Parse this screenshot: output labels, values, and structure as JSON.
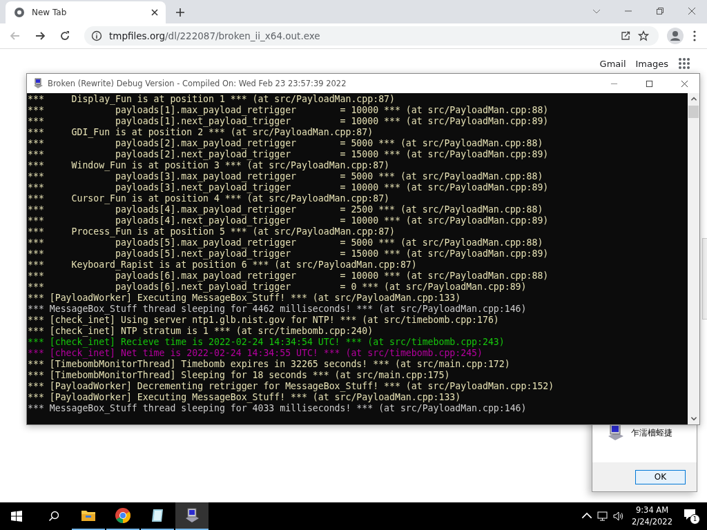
{
  "browser": {
    "tab": {
      "title": "New Tab",
      "selected": true
    },
    "url_host": "tmpfiles.org",
    "url_path": "/dl/222087/broken_ii_x64.out.exe",
    "page_links": [
      "Gmail",
      "Images"
    ]
  },
  "console": {
    "title": "Broken (Rewrite) Debug Version - Compiled On: Wed Feb 23 23:57:39 2022",
    "lines": [
      {
        "text": "***     Display_Fun is at position 1 *** (at src/PayloadMan.cpp:87)",
        "kind": "normal"
      },
      {
        "text": "***             payloads[1].max_payload_retrigger        = 10000 *** (at src/PayloadMan.cpp:88)",
        "kind": "normal"
      },
      {
        "text": "***             payloads[1].next_payload_trigger         = 10000 *** (at src/PayloadMan.cpp:89)",
        "kind": "normal"
      },
      {
        "text": "***     GDI_Fun is at position 2 *** (at src/PayloadMan.cpp:87)",
        "kind": "normal"
      },
      {
        "text": "***             payloads[2].max_payload_retrigger        = 5000 *** (at src/PayloadMan.cpp:88)",
        "kind": "normal"
      },
      {
        "text": "***             payloads[2].next_payload_trigger         = 15000 *** (at src/PayloadMan.cpp:89)",
        "kind": "normal"
      },
      {
        "text": "***     Window_Fun is at position 3 *** (at src/PayloadMan.cpp:87)",
        "kind": "normal"
      },
      {
        "text": "***             payloads[3].max_payload_retrigger        = 5000 *** (at src/PayloadMan.cpp:88)",
        "kind": "normal"
      },
      {
        "text": "***             payloads[3].next_payload_trigger         = 10000 *** (at src/PayloadMan.cpp:89)",
        "kind": "normal"
      },
      {
        "text": "***     Cursor_Fun is at position 4 *** (at src/PayloadMan.cpp:87)",
        "kind": "normal"
      },
      {
        "text": "***             payloads[4].max_payload_retrigger        = 2500 *** (at src/PayloadMan.cpp:88)",
        "kind": "normal"
      },
      {
        "text": "***             payloads[4].next_payload_trigger         = 10000 *** (at src/PayloadMan.cpp:89)",
        "kind": "normal"
      },
      {
        "text": "***     Process_Fun is at position 5 *** (at src/PayloadMan.cpp:87)",
        "kind": "normal"
      },
      {
        "text": "***             payloads[5].max_payload_retrigger        = 5000 *** (at src/PayloadMan.cpp:88)",
        "kind": "normal"
      },
      {
        "text": "***             payloads[5].next_payload_trigger         = 15000 *** (at src/PayloadMan.cpp:89)",
        "kind": "normal"
      },
      {
        "text": "***     Keyboard_Rapist is at position 6 *** (at src/PayloadMan.cpp:87)",
        "kind": "normal"
      },
      {
        "text": "***             payloads[6].max_payload_retrigger        = 10000 *** (at src/PayloadMan.cpp:88)",
        "kind": "normal"
      },
      {
        "text": "***             payloads[6].next_payload_trigger         = 0 *** (at src/PayloadMan.cpp:89)",
        "kind": "normal"
      },
      {
        "text": "*** [PayloadWorker] Executing MessageBox_Stuff! *** (at src/PayloadMan.cpp:133)",
        "kind": "normal"
      },
      {
        "text": "*** MessageBox_Stuff thread sleeping for 4462 milliseconds! *** (at src/PayloadMan.cpp:146)",
        "kind": "dim"
      },
      {
        "text": "*** [check_inet] Using server ntp1.glb.nist.gov for NTP! *** (at src/timebomb.cpp:176)",
        "kind": "normal"
      },
      {
        "text": "*** [check_inet] NTP stratum is 1 *** (at src/timebomb.cpp:240)",
        "kind": "normal"
      },
      {
        "text": "*** [check_inet] Recieve time is 2022-02-24 14:34:54 UTC! *** (at src/timebomb.cpp:243)",
        "kind": "success"
      },
      {
        "text": "*** [check_inet] Net time is 2022-02-24 14:34:55 UTC! *** (at src/timebomb.cpp:245)",
        "kind": "error"
      },
      {
        "text": "*** [TimebombMonitorThread] Timebomb expires in 32265 seconds! *** (at src/main.cpp:172)",
        "kind": "normal"
      },
      {
        "text": "*** [TimebombMonitorThread] Sleeping for 18 seconds *** (at src/main.cpp:175)",
        "kind": "normal"
      },
      {
        "text": "*** [PayloadWorker] Decrementing retrigger for MessageBox_Stuff! *** (at src/PayloadMan.cpp:152)",
        "kind": "normal"
      },
      {
        "text": "*** [PayloadWorker] Executing MessageBox_Stuff! *** (at src/PayloadMan.cpp:133)",
        "kind": "normal"
      },
      {
        "text": "*** MessageBox_Stuff thread sleeping for 4033 milliseconds! *** (at src/PayloadMan.cpp:146)",
        "kind": "dim"
      }
    ]
  },
  "dialog": {
    "message": "乍濡檣蛭捷",
    "button": "OK"
  },
  "taskbar": {
    "apps": [
      {
        "kind": "folder",
        "selected": false
      },
      {
        "kind": "browser",
        "selected": false
      },
      {
        "kind": "notepad",
        "selected": false
      },
      {
        "kind": "console",
        "selected": true
      }
    ],
    "time": "9:34 AM",
    "date": "2/24/2022",
    "notifications": "1"
  }
}
